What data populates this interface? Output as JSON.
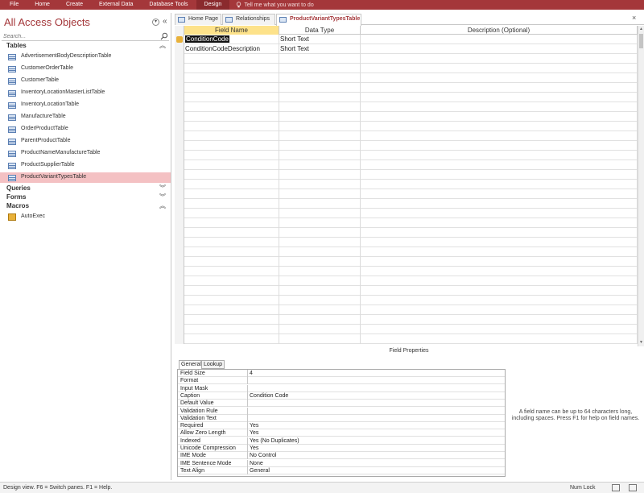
{
  "ribbon": {
    "tabs": [
      "File",
      "Home",
      "Create",
      "External Data",
      "Database Tools",
      "Design"
    ],
    "active_tab": "Design",
    "tell_me": "Tell me what you want to do"
  },
  "nav": {
    "title": "All Access Objects",
    "search_placeholder": "Search...",
    "groups": {
      "tables": {
        "label": "Tables",
        "items": [
          "AdvertisementBodyDescriptionTable",
          "CustomerOrderTable",
          "CustomerTable",
          "InventoryLocationMasterListTable",
          "InventoryLocationTable",
          "ManufactureTable",
          "OrderProductTable",
          "ParentProductTable",
          "ProductNameManufactureTable",
          "ProductSupplierTable",
          "ProductVariantTypesTable"
        ],
        "selected": "ProductVariantTypesTable"
      },
      "queries": {
        "label": "Queries"
      },
      "forms": {
        "label": "Forms"
      },
      "macros": {
        "label": "Macros",
        "items": [
          "AutoExec"
        ]
      }
    }
  },
  "doc_tabs": [
    "Home Page",
    "Relationships",
    "ProductVariantTypesTable"
  ],
  "active_doc_tab": "ProductVariantTypesTable",
  "grid": {
    "headers": {
      "field_name": "Field Name",
      "data_type": "Data Type",
      "description": "Description (Optional)"
    },
    "rows": [
      {
        "field_name": "ConditionCode",
        "data_type": "Short Text",
        "description": ""
      },
      {
        "field_name": "ConditionCodeDescription",
        "data_type": "Short Text",
        "description": ""
      }
    ]
  },
  "field_properties": {
    "title": "Field Properties",
    "tabs": [
      "General",
      "Lookup"
    ],
    "active_tab": "General",
    "rows": [
      {
        "label": "Field Size",
        "value": "4"
      },
      {
        "label": "Format",
        "value": ""
      },
      {
        "label": "Input Mask",
        "value": ""
      },
      {
        "label": "Caption",
        "value": "Condition Code"
      },
      {
        "label": "Default Value",
        "value": ""
      },
      {
        "label": "Validation Rule",
        "value": ""
      },
      {
        "label": "Validation Text",
        "value": ""
      },
      {
        "label": "Required",
        "value": "Yes"
      },
      {
        "label": "Allow Zero Length",
        "value": "Yes"
      },
      {
        "label": "Indexed",
        "value": "Yes (No Duplicates)"
      },
      {
        "label": "Unicode Compression",
        "value": "Yes"
      },
      {
        "label": "IME Mode",
        "value": "No Control"
      },
      {
        "label": "IME Sentence Mode",
        "value": "None"
      },
      {
        "label": "Text Align",
        "value": "General"
      }
    ],
    "help_text": "A field name can be up to 64 characters long, including spaces. Press F1 for help on field names."
  },
  "status": {
    "text": "Design view.  F6 = Switch panes.  F1 = Help.",
    "num_lock": "Num Lock"
  }
}
